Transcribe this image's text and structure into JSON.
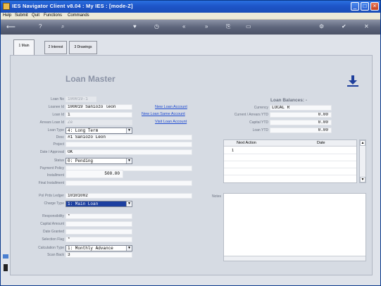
{
  "window": {
    "title": "IES Navigator Client v8.04 : My IES :      [mode-Z]"
  },
  "menu": [
    "Help",
    "Submit",
    "Quit",
    "Functions",
    "Commands"
  ],
  "toolbar": {
    "icons": [
      "back-arrow-icon",
      "help-icon",
      "search-icon",
      "heart-icon",
      "clock-icon",
      "rewind-icon",
      "forward-icon",
      "copy-icon",
      "document-icon",
      "gear-icon",
      "check-icon",
      "close-icon"
    ]
  },
  "tabs": [
    {
      "label": "1 Main",
      "active": true
    },
    {
      "label": "2 Interest",
      "active": false
    },
    {
      "label": "3 Drawings",
      "active": false
    }
  ],
  "page_title": "Loan Master",
  "form": {
    "loan_no": {
      "label": "Loan No",
      "value": "100019-1"
    },
    "loanee_id": {
      "label": "Loanee Id",
      "value": "100019 Saniozo leon"
    },
    "loan_id": {
      "label": "Loan Id",
      "value": "1"
    },
    "arrears_loan_id": {
      "label": "Arrears Loan Id",
      "value": "Ze"
    },
    "loan_type": {
      "label": "Loan Type",
      "value": "4: Long Term"
    },
    "desc": {
      "label": "Desc",
      "value": "#1 Saniozo Leon"
    },
    "project": {
      "label": "Project",
      "value": ""
    },
    "date_approval": {
      "label": "Date / Approval",
      "value": "OK"
    },
    "status": {
      "label": "Status",
      "value": "0: Pending"
    },
    "payment_policy": {
      "label": "Payment Policy",
      "value": ""
    },
    "installment": {
      "label": "Installment",
      "value": "500.00"
    },
    "final_installment": {
      "label": "Final Installment",
      "value": ""
    },
    "pol_prds_ledger": {
      "label": "Pol Prds Ledger",
      "value": "10101002"
    },
    "charge_type": {
      "label": "Charge Type",
      "value": "1: Main Loan"
    },
    "responsibility": {
      "label": "Responsibility",
      "value": "*"
    },
    "capital_amount": {
      "label": "Capital Amount",
      "value": ""
    },
    "date_granted": {
      "label": "Date Granted",
      "value": ""
    },
    "selection_flag": {
      "label": "Selection Flag",
      "value": "*"
    },
    "calculation_type": {
      "label": "Calculation Type",
      "value": "1: Monthly Advance"
    },
    "scan_back": {
      "label": "Scan Back",
      "value": "3"
    }
  },
  "links": {
    "new_loan_account": "New Loan Account",
    "new_loan_same_account": "New Loan Same Account",
    "visit_loan_account": "Visit Loan Account"
  },
  "balances": {
    "title": "Loan Balances: -",
    "currency": {
      "label": "Currency",
      "value": "LOCAL R"
    },
    "current_arrears_ytd": {
      "label": "Current / Arrears YTD",
      "value": "0.00"
    },
    "capital_ytd": {
      "label": "Capital YTD",
      "value": "0.00"
    },
    "loan_ytd": {
      "label": "Loan YTD",
      "value": "0.00"
    }
  },
  "next_action": {
    "columns": [
      "Next Action",
      "Date"
    ],
    "rows": [
      {
        "num": "1",
        "action": "",
        "date": ""
      }
    ]
  },
  "notes": {
    "label": "Notes"
  },
  "colors": {
    "titlebar": "#1e55c8",
    "link": "#1f4bd0",
    "selected": "#1c3fa0"
  }
}
